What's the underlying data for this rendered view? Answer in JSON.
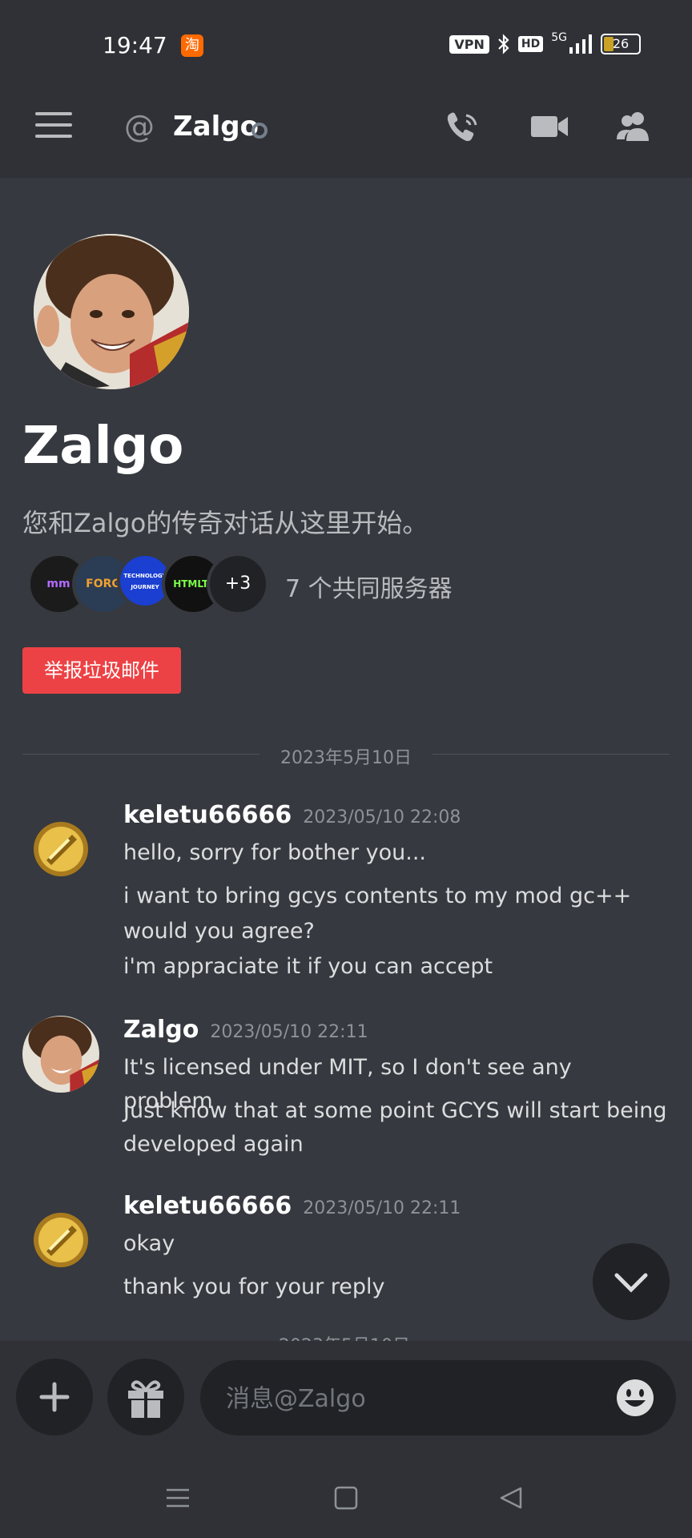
{
  "status_bar": {
    "time": "19:47",
    "app_badge": "淘",
    "vpn": "VPN",
    "hd": "HD",
    "network": "5G",
    "battery": "26"
  },
  "header": {
    "title": "Zalgo"
  },
  "intro": {
    "name": "Zalgo",
    "subtitle": "您和Zalgo的传奇对话从这里开始。",
    "servers": [
      {
        "label": "mm",
        "color": "#1b1b1b",
        "text_color": "#b36bff"
      },
      {
        "label": "FORG",
        "color": "#2a3d55",
        "text_color": "#f0a030"
      },
      {
        "label": "TECHNOLOGY JOURNEY",
        "color": "#1a3fd1",
        "text_color": "#ffffff"
      },
      {
        "label": "HTMLTs",
        "color": "#111111",
        "text_color": "#7cff4a"
      }
    ],
    "servers_more": "+3",
    "mutual_text": "7 个共同服务器",
    "report_label": "举报垃圾邮件"
  },
  "date_divider": "2023年5月10日",
  "messages": [
    {
      "author": "keletu66666",
      "time": "2023/05/10 22:08",
      "lines": [
        "hello, sorry for bother you...",
        "i want to bring gcys contents to my mod gc++",
        "would you agree?",
        "i'm appraciate it if you can accept"
      ]
    },
    {
      "author": "Zalgo",
      "time": "2023/05/10 22:11",
      "lines": [
        "It's licensed under MIT, so I don't see any problem",
        "Just know that at some point GCYS will start being",
        "developed again"
      ]
    },
    {
      "author": "keletu66666",
      "time": "2023/05/10 22:11",
      "lines": [
        "okay",
        "thank you for your reply"
      ]
    }
  ],
  "input": {
    "placeholder": "消息@Zalgo"
  },
  "colors": {
    "background": "#36393f",
    "header": "#2f3136",
    "danger": "#ed4245"
  }
}
